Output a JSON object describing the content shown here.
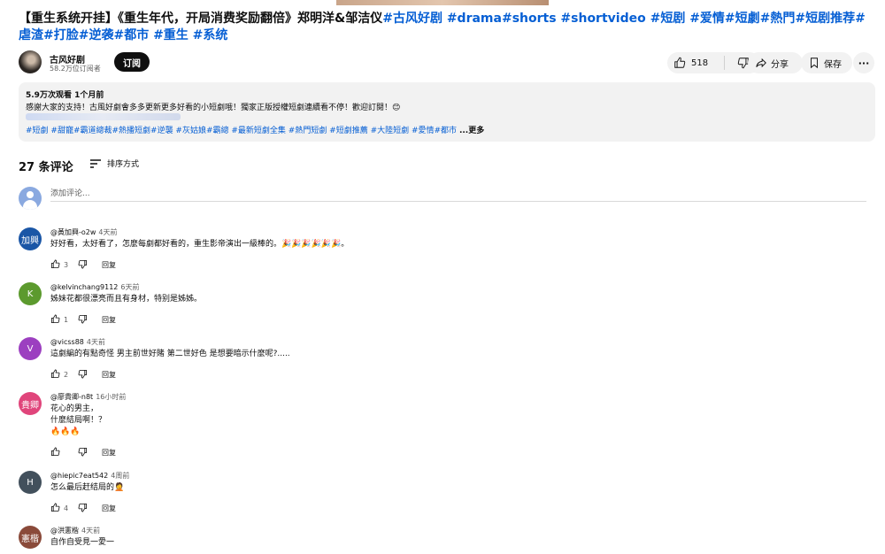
{
  "video": {
    "title_main": "【重生系统开挂】《重生年代，开局消费奖励翻倍》郑明洋&邹洁仪",
    "title_tags": "#古风好剧 #drama#shorts #shortvideo #短剧 #爱情#短劇#熱門#短剧推荐#虐渣#打脸#逆袭#都市 #重生 #系统"
  },
  "channel": {
    "name": "古风好剧",
    "subscribers": "58.2万位订阅者",
    "subscribe_label": "订阅"
  },
  "actions": {
    "like_count": "518",
    "share_label": "分享",
    "save_label": "保存",
    "more_label": "···"
  },
  "description": {
    "meta": "5.9万次观看  1个月前",
    "text": "感謝大家的支持！古風好劇會多多更新更多好看的小短劇哦！獨家正版授權短劇連續看不停！歡迎訂閱！😊",
    "tags": "#短劇 #甜寵#霸道總裁#熱播短劇#逆襲 #灰姑娘#霸總 #最新短劇全集 #熱門短劇 #短劇推薦 #大陸短劇 #愛情#都市",
    "more_label": "...更多"
  },
  "comments_section": {
    "count_label": "27 条评论",
    "sort_label": "排序方式",
    "add_placeholder": "添加评论...",
    "reply_label": "回复"
  },
  "comments": [
    {
      "avatar_text": "加興",
      "avatar_color": "#1a56a6",
      "author": "@黃加興-o2w",
      "time": "4天前",
      "text": "好好看，太好看了，怎麼每劇都好看的，重生影帝演出一級棒的。🎉🎉🎉🎉🎉🎉。",
      "likes": "3"
    },
    {
      "avatar_text": "K",
      "avatar_color": "#5c9a2e",
      "author": "@kelvinchang9112",
      "time": "6天前",
      "text": "姊妹花都很漂亮而且有身材，特别是姊姊。",
      "likes": "1"
    },
    {
      "avatar_text": "V",
      "avatar_color": "#9c3fc0",
      "author": "@vicss88",
      "time": "4天前",
      "text": "這劇編的有點奇怪  男主前世好賭  第二世好色  是想要暗示什麼呢?.....",
      "likes": "2"
    },
    {
      "avatar_text": "貴卿",
      "avatar_color": "#e0457b",
      "author": "@廖貴卿-n8t",
      "time": "16小时前",
      "text": "花心的男主，\n什麼結局啊！？\n🔥🔥🔥",
      "likes": ""
    },
    {
      "avatar_text": "H",
      "avatar_color": "#42505c",
      "author": "@hiepic7eat542",
      "time": "4周前",
      "text": "怎么最后赶结局的🤦",
      "likes": "4"
    },
    {
      "avatar_text": "憲楷",
      "avatar_color": "#8a4a3a",
      "author": "@洪憲楷",
      "time": "4天前",
      "text": "自作自受見一愛一",
      "likes": ""
    }
  ]
}
